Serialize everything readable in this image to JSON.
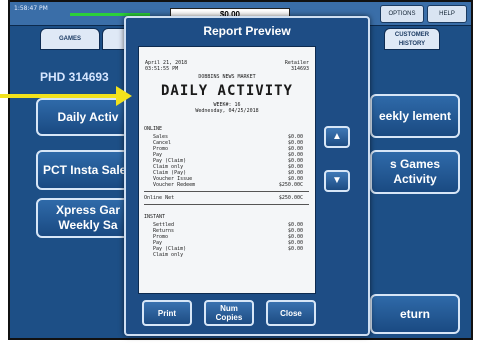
{
  "topbar": {
    "left_text": "1:58:47 PM",
    "amount": "$0.00",
    "btn_options": "OPTIONS",
    "btn_help": "HELP"
  },
  "tabs": [
    {
      "label": "GAMES"
    },
    {
      "label": "CUSTOMER HISTORY"
    }
  ],
  "left_panel": {
    "terminal_id": "PHD 314693",
    "btn_daily": "Daily Activ",
    "btn_pct": "PCT Insta Sales",
    "btn_xpress": "Xpress Gar Weekly Sa"
  },
  "right_panel": {
    "btn_weekly": "eekly lement",
    "btn_games": "s Games Activity",
    "btn_return": "eturn"
  },
  "modal": {
    "title": "Report Preview",
    "scroll_up": "▲",
    "scroll_down": "▼",
    "buttons": {
      "print": "Print",
      "num_copies": "Num Copies",
      "close": "Close"
    }
  },
  "report": {
    "date": "April 21, 2018",
    "time": "03:51:55 PM",
    "retailer_label": "Retailer",
    "retailer_no": "314693",
    "store_name": "DOBBINS NEWS MARKET",
    "title": "DAILY ACTIVITY",
    "week": "WEEK#: 16",
    "day": "Wednesday, 04/25/2018",
    "sales_header": "ONLINE",
    "sales_rows": [
      {
        "label": "Sales",
        "value": "$0.00"
      },
      {
        "label": "Cancel",
        "value": "$0.00"
      },
      {
        "label": "Promo",
        "value": "$0.00"
      },
      {
        "label": "Pay",
        "value": "$0.00"
      },
      {
        "label": "Pay (Claim)",
        "value": "$0.00"
      },
      {
        "label": "Claim only",
        "value": "$0.00"
      },
      {
        "label": "Claim (Pay)",
        "value": "$0.00"
      },
      {
        "label": "Voucher Issue",
        "value": "$0.00"
      },
      {
        "label": "Voucher Redeem",
        "value": "$250.00C"
      }
    ],
    "online_net_label": "Online Net",
    "online_net_value": "$250.00C",
    "instant_header": "INSTANT",
    "instant_rows": [
      {
        "label": "Settled",
        "value": "$0.00"
      },
      {
        "label": "Returns",
        "value": "$0.00"
      },
      {
        "label": "Promo",
        "value": "$0.00"
      },
      {
        "label": "Pay",
        "value": "$0.00"
      },
      {
        "label": "Pay (Claim)",
        "value": "$0.00"
      },
      {
        "label": "Claim only",
        "value": ""
      }
    ]
  }
}
